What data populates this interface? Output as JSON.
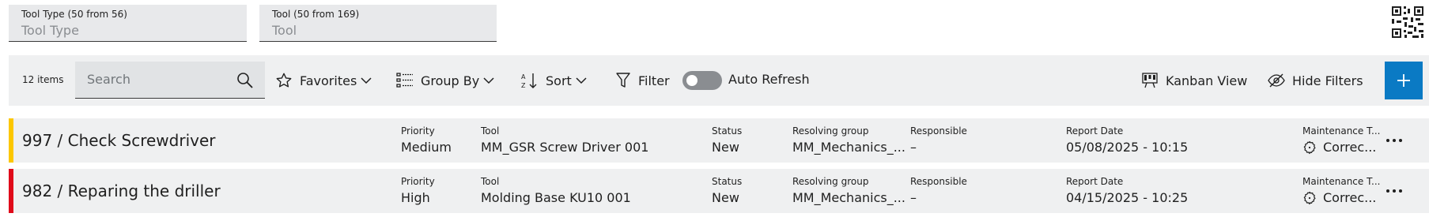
{
  "filters": {
    "tool_type": {
      "label": "Tool Type (50 from 56)",
      "placeholder": "Tool Type"
    },
    "tool": {
      "label": "Tool (50 from 169)",
      "placeholder": "Tool"
    }
  },
  "toolbar": {
    "count": "12 items",
    "search_placeholder": "Search",
    "favorites": "Favorites",
    "group_by": "Group By",
    "sort": "Sort",
    "filter": "Filter",
    "auto_refresh": "Auto Refresh",
    "auto_refresh_on": false,
    "kanban_view": "Kanban View",
    "hide_filters": "Hide Filters",
    "accent": "#0a7ac4"
  },
  "field_labels": {
    "priority": "Priority",
    "tool": "Tool",
    "status": "Status",
    "resolving_group": "Resolving group",
    "responsible": "Responsible",
    "report_date": "Report Date",
    "maintenance_type": "Maintenance T..."
  },
  "rows": [
    {
      "title": "997 / Check Screwdriver",
      "stripe_color": "#fcc700",
      "priority": "Medium",
      "tool": "MM_GSR Screw Driver 001",
      "status": "New",
      "resolving_group": "MM_Mechanics_...",
      "responsible": "–",
      "report_date": "05/08/2025 - 10:15",
      "maintenance_type": "Correc..."
    },
    {
      "title": "982 / Reparing the driller",
      "stripe_color": "#e00a1a",
      "priority": "High",
      "tool": "Molding Base KU10 001",
      "status": "New",
      "resolving_group": "MM_Mechanics_...",
      "responsible": "–",
      "report_date": "04/15/2025 - 10:25",
      "maintenance_type": "Correc..."
    }
  ]
}
